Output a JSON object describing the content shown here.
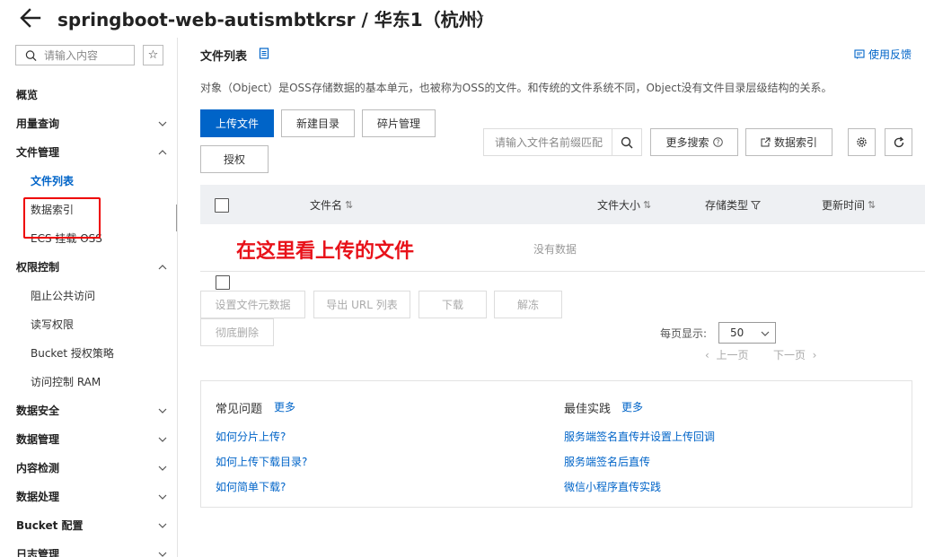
{
  "header": {
    "title": "springboot-web-autismbtkrsr / 华东1（杭州）"
  },
  "sidebar": {
    "search_placeholder": "请输入内容",
    "star": "☆",
    "items": [
      {
        "label": "概览",
        "type": "group"
      },
      {
        "label": "用量查询",
        "type": "group",
        "chevron": "down"
      },
      {
        "label": "文件管理",
        "type": "group",
        "chevron": "up"
      },
      {
        "label": "文件列表",
        "type": "sub",
        "active": true
      },
      {
        "label": "数据索引",
        "type": "sub"
      },
      {
        "label": "ECS 挂载 OSS",
        "type": "sub"
      },
      {
        "label": "权限控制",
        "type": "group",
        "chevron": "up"
      },
      {
        "label": "阻止公共访问",
        "type": "sub"
      },
      {
        "label": "读写权限",
        "type": "sub"
      },
      {
        "label": "Bucket 授权策略",
        "type": "sub"
      },
      {
        "label": "访问控制 RAM",
        "type": "sub"
      },
      {
        "label": "数据安全",
        "type": "group",
        "chevron": "down"
      },
      {
        "label": "数据管理",
        "type": "group",
        "chevron": "down"
      },
      {
        "label": "内容检测",
        "type": "group",
        "chevron": "down"
      },
      {
        "label": "数据处理",
        "type": "group",
        "chevron": "down"
      },
      {
        "label": "Bucket 配置",
        "type": "group",
        "chevron": "down"
      },
      {
        "label": "日志管理",
        "type": "group",
        "chevron": "down"
      }
    ]
  },
  "main": {
    "page_title": "文件列表",
    "feedback": "使用反馈",
    "description": "对象（Object）是OSS存储数据的基本单元，也被称为OSS的文件。和传统的文件系统不同，Object没有文件目录层级结构的关系。",
    "toolbar": {
      "upload": "上传文件",
      "new_dir": "新建目录",
      "fragments": "碎片管理",
      "authorize": "授权",
      "search_placeholder": "请输入文件名前缀匹配",
      "more_search": "更多搜索",
      "data_index": "数据索引"
    },
    "table": {
      "columns": [
        "文件名",
        "文件大小",
        "存储类型",
        "更新时间"
      ],
      "empty": "没有数据",
      "annotation": "在这里看上传的文件"
    },
    "bulk_actions": {
      "set_meta": "设置文件元数据",
      "export_url": "导出 URL 列表",
      "download": "下载",
      "unfreeze": "解冻",
      "delete": "彻底删除"
    },
    "pagination": {
      "page_size_label": "每页显示:",
      "page_size": "50",
      "prev": "上一页",
      "next": "下一页"
    },
    "faq": {
      "title": "常见问题",
      "more": "更多",
      "links": [
        "如何分片上传?",
        "如何上传下载目录?",
        "如何简单下载?"
      ]
    },
    "best": {
      "title": "最佳实践",
      "more": "更多",
      "links": [
        "服务端签名直传并设置上传回调",
        "服务端签名后直传",
        "微信小程序直传实践"
      ]
    }
  }
}
